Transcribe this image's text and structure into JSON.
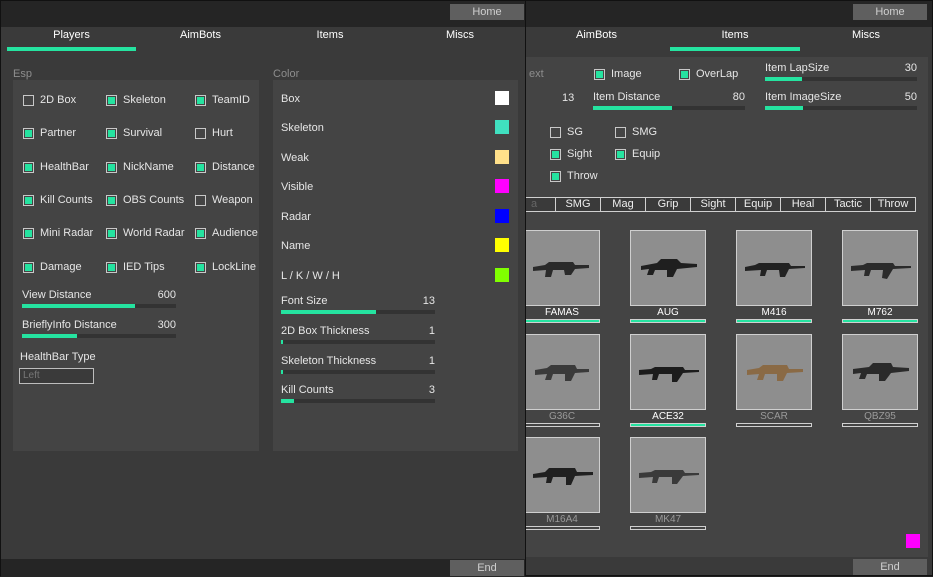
{
  "right_window": {
    "home_label": "Home",
    "end_label": "End",
    "tabs": [
      {
        "label": "AimBots",
        "active": false
      },
      {
        "label": "Items",
        "active": true
      },
      {
        "label": "Miscs",
        "active": false
      }
    ],
    "checkboxes_top": [
      {
        "label": "ext",
        "checked": false
      },
      {
        "label": "Image",
        "checked": true
      },
      {
        "label": "OverLap",
        "checked": true
      }
    ],
    "sliders": [
      {
        "label": "Item LapSize",
        "value": "30",
        "fill": 0.3
      },
      {
        "label": "Item Distance",
        "value": "80",
        "fill": 0.52
      },
      {
        "label": "Item ImageSize",
        "value": "50",
        "fill": 0.22
      }
    ],
    "cut_value": "13",
    "type_checkboxes": [
      {
        "label": "SG",
        "checked": false
      },
      {
        "label": "SMG",
        "checked": false
      },
      {
        "label": "Sight",
        "checked": true
      },
      {
        "label": "Equip",
        "checked": true
      },
      {
        "label": "Throw",
        "checked": true
      }
    ],
    "categories": [
      "a",
      "SMG",
      "Mag",
      "Grip",
      "Sight",
      "Equip",
      "Heal",
      "Tactic",
      "Throw"
    ],
    "items": [
      {
        "name": "FAMAS",
        "enabled": true
      },
      {
        "name": "AUG",
        "enabled": true
      },
      {
        "name": "M416",
        "enabled": true
      },
      {
        "name": "M762",
        "enabled": true
      },
      {
        "name": "G36C",
        "enabled": false
      },
      {
        "name": "ACE32",
        "enabled": true
      },
      {
        "name": "SCAR",
        "enabled": false
      },
      {
        "name": "QBZ95",
        "enabled": false
      },
      {
        "name": "M16A4",
        "enabled": false
      },
      {
        "name": "MK47",
        "enabled": false
      }
    ],
    "corner_swatch_color": "#ff00ff"
  },
  "left_window": {
    "home_label": "Home",
    "end_label": "End",
    "tabs": [
      {
        "label": "Players",
        "active": true
      },
      {
        "label": "AimBots",
        "active": false
      },
      {
        "label": "Items",
        "active": false
      },
      {
        "label": "Miscs",
        "active": false
      }
    ],
    "esp": {
      "title": "Esp",
      "checkboxes": [
        {
          "label": "2D Box",
          "checked": false
        },
        {
          "label": "Skeleton",
          "checked": true
        },
        {
          "label": "TeamID",
          "checked": true
        },
        {
          "label": "Partner",
          "checked": true
        },
        {
          "label": "Survival",
          "checked": true
        },
        {
          "label": "Hurt",
          "checked": false
        },
        {
          "label": "HealthBar",
          "checked": true
        },
        {
          "label": "NickName",
          "checked": true
        },
        {
          "label": "Distance",
          "checked": true
        },
        {
          "label": "Kill Counts",
          "checked": true
        },
        {
          "label": "OBS Counts",
          "checked": true
        },
        {
          "label": "Weapon",
          "checked": false
        },
        {
          "label": "Mini Radar",
          "checked": true
        },
        {
          "label": "World Radar",
          "checked": true
        },
        {
          "label": "Audience",
          "checked": true
        },
        {
          "label": "Damage",
          "checked": true
        },
        {
          "label": "IED Tips",
          "checked": true
        },
        {
          "label": "LockLine",
          "checked": true
        }
      ],
      "sliders": [
        {
          "label": "View Distance",
          "value": "600",
          "fill": 0.73
        },
        {
          "label": "BrieflyInfo Distance",
          "value": "300",
          "fill": 0.36
        }
      ],
      "healthbar_type_label": "HealthBar Type",
      "healthbar_type_value": "Left"
    },
    "color": {
      "title": "Color",
      "rows": [
        {
          "label": "Box",
          "color": "#ffffff"
        },
        {
          "label": "Skeleton",
          "color": "#40e0c0"
        },
        {
          "label": "Weak",
          "color": "#ffe08a"
        },
        {
          "label": "Visible",
          "color": "#ff00ff"
        },
        {
          "label": "Radar",
          "color": "#0000ff"
        },
        {
          "label": "Name",
          "color": "#ffff00"
        },
        {
          "label": "L / K / W / H",
          "color": "#80ff00"
        }
      ],
      "sliders": [
        {
          "label": "Font Size",
          "value": "13",
          "fill": 0.62
        },
        {
          "label": "2D Box Thickness",
          "value": "1",
          "fill": 0.01
        },
        {
          "label": "Skeleton Thickness",
          "value": "1",
          "fill": 0.01
        },
        {
          "label": "Kill Counts",
          "value": "3",
          "fill": 0.08
        }
      ]
    }
  }
}
